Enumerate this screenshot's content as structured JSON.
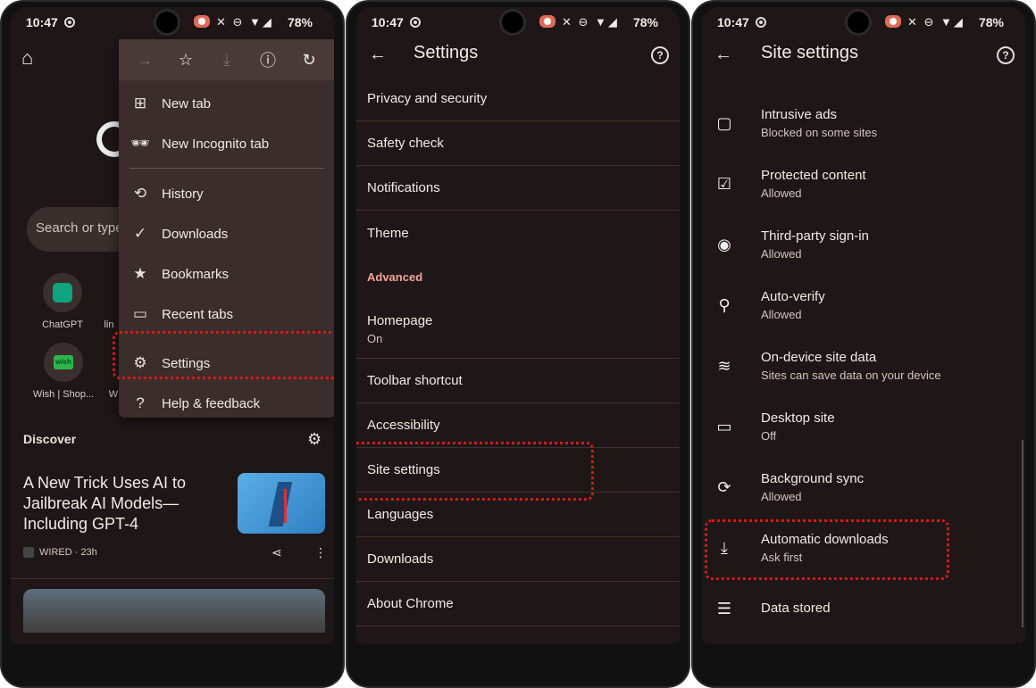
{
  "status": {
    "time": "10:47",
    "battery": "78%"
  },
  "phone1": {
    "search_placeholder": "Search or type",
    "tiles": [
      {
        "label": "ChatGPT"
      },
      {
        "label": "lin"
      },
      {
        "label": "Wish | Shop..."
      },
      {
        "label": "W"
      }
    ],
    "wish_logo_text": "wish",
    "menu": {
      "items": [
        {
          "label": "New tab",
          "icon": "plus-box-icon"
        },
        {
          "label": "New Incognito tab",
          "icon": "incognito-icon"
        },
        {
          "label": "History",
          "icon": "history-icon"
        },
        {
          "label": "Downloads",
          "icon": "download-check-icon"
        },
        {
          "label": "Bookmarks",
          "icon": "star-icon"
        },
        {
          "label": "Recent tabs",
          "icon": "devices-icon"
        },
        {
          "label": "Settings",
          "icon": "gear-icon"
        },
        {
          "label": "Help & feedback",
          "icon": "help-icon"
        }
      ]
    },
    "discover": "Discover",
    "article": {
      "title": "A New Trick Uses AI to Jailbreak AI Models—Including GPT-4",
      "source": "WIRED · 23h"
    }
  },
  "phone2": {
    "title": "Settings",
    "items": [
      {
        "label": "Privacy and security"
      },
      {
        "label": "Safety check"
      },
      {
        "label": "Notifications"
      },
      {
        "label": "Theme"
      }
    ],
    "section": "Advanced",
    "homepage": {
      "label": "Homepage",
      "sub": "On"
    },
    "items2": [
      {
        "label": "Toolbar shortcut"
      },
      {
        "label": "Accessibility"
      },
      {
        "label": "Site settings"
      },
      {
        "label": "Languages"
      },
      {
        "label": "Downloads"
      },
      {
        "label": "About Chrome"
      }
    ]
  },
  "phone3": {
    "title": "Site settings",
    "items": [
      {
        "label": "Intrusive ads",
        "sub": "Blocked on some sites",
        "icon": "window-icon"
      },
      {
        "label": "Protected content",
        "sub": "Allowed",
        "icon": "protected-content-icon"
      },
      {
        "label": "Third-party sign-in",
        "sub": "Allowed",
        "icon": "account-icon"
      },
      {
        "label": "Auto-verify",
        "sub": "Allowed",
        "icon": "person-verify-icon"
      },
      {
        "label": "On-device site data",
        "sub": "Sites can save data on your device",
        "icon": "database-icon"
      },
      {
        "label": "Desktop site",
        "sub": "Off",
        "icon": "monitor-icon"
      },
      {
        "label": "Background sync",
        "sub": "Allowed",
        "icon": "sync-icon"
      },
      {
        "label": "Automatic downloads",
        "sub": "Ask first",
        "icon": "download-icon"
      },
      {
        "label": "Data stored",
        "sub": "",
        "icon": "storage-icon"
      }
    ]
  },
  "colors": {
    "highlight": "#d31a1a",
    "background": "#1f1717",
    "section": "#f2a59b"
  }
}
